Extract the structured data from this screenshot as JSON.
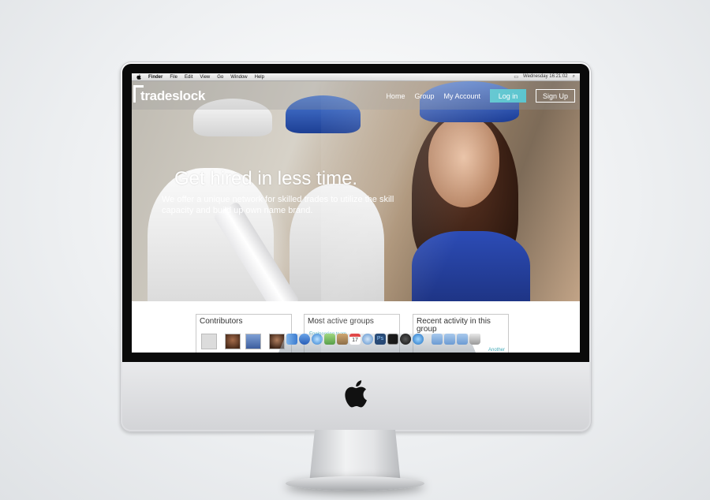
{
  "menubar": {
    "items": [
      "Finder",
      "File",
      "Edit",
      "View",
      "Go",
      "Window",
      "Help"
    ],
    "clock": "Wednesday 16:21:02"
  },
  "site": {
    "logo": "tradeslock",
    "nav": [
      "Home",
      "Group",
      "My Account"
    ],
    "login_label": "Log in",
    "signup_label": "Sign Up",
    "accent_color": "#5cc5cf"
  },
  "hero": {
    "headline": "Get hired in less time.",
    "subline": "We offer a unique network for skilled trades to utilize the skill capacity and build up own name brand."
  },
  "cards": {
    "contributors_title": "Contributors",
    "groups_title": "Most active groups",
    "groups_first": "Engineering team",
    "activity_title": "Recent activity in this group",
    "activity_snippet": "Another"
  },
  "dock": {
    "icons": [
      "finder-icon",
      "app-store-icon",
      "safari-icon",
      "mail-icon",
      "address-book-icon",
      "calendar-icon",
      "itunes-icon",
      "photoshop-icon",
      "terminal-icon",
      "time-machine-icon",
      "quicktime-icon",
      "folder-icon",
      "folder-icon",
      "folder-icon",
      "trash-icon"
    ],
    "calendar_day": "17"
  }
}
